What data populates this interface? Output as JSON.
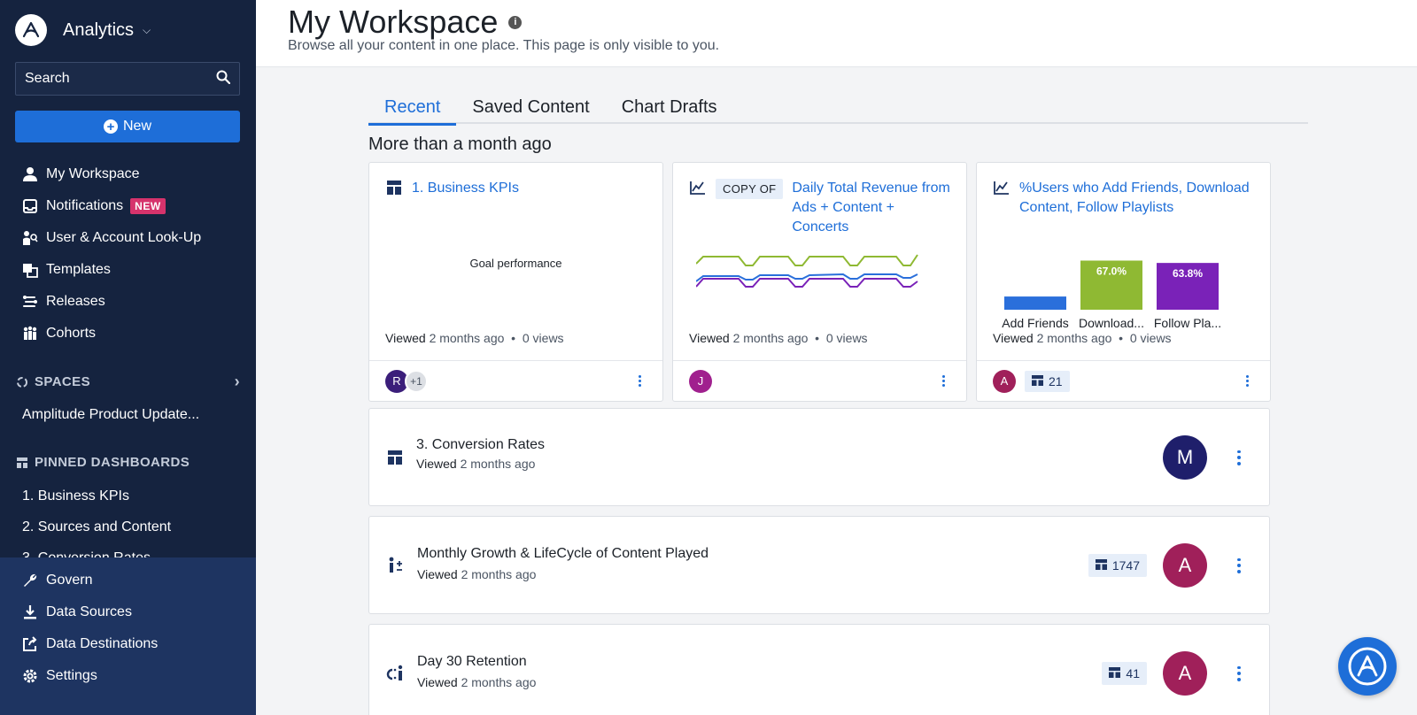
{
  "brand": {
    "name": "Analytics"
  },
  "search": {
    "label": "Search"
  },
  "new_button": {
    "label": "New"
  },
  "nav": {
    "items": [
      {
        "label": "My Workspace",
        "icon": "person-icon"
      },
      {
        "label": "Notifications",
        "icon": "inbox-icon",
        "badge": "NEW"
      },
      {
        "label": "User & Account Look-Up",
        "icon": "user-lookup-icon"
      },
      {
        "label": "Templates",
        "icon": "templates-icon"
      },
      {
        "label": "Releases",
        "icon": "releases-icon"
      },
      {
        "label": "Cohorts",
        "icon": "cohorts-icon"
      }
    ]
  },
  "spaces": {
    "title": "SPACES",
    "items": [
      "Amplitude Product Update..."
    ]
  },
  "pinned": {
    "title": "PINNED DASHBOARDS",
    "items": [
      "1. Business KPIs",
      "2. Sources and Content",
      "3. Conversion Rates"
    ]
  },
  "bottom_nav": {
    "items": [
      {
        "label": "Govern",
        "icon": "wrench-icon"
      },
      {
        "label": "Data Sources",
        "icon": "download-icon"
      },
      {
        "label": "Data Destinations",
        "icon": "share-icon"
      },
      {
        "label": "Settings",
        "icon": "gear-icon"
      }
    ]
  },
  "header": {
    "title": "My Workspace",
    "subtitle": "Browse all your content in one place. This page is only visible to you."
  },
  "tabs": [
    "Recent",
    "Saved Content",
    "Chart Drafts"
  ],
  "group_title": "More than a month ago",
  "cards": [
    {
      "title": "1. Business KPIs",
      "preview_text": "Goal performance",
      "viewed_label": "Viewed",
      "viewed_time": "2 months ago",
      "views": "0 views",
      "avatar": "R",
      "avatar_color": "#3b1e7a",
      "extra": "+1"
    },
    {
      "copy_label": "COPY OF",
      "title": "Daily Total Revenue from Ads + Content + Concerts",
      "viewed_label": "Viewed",
      "viewed_time": "2 months ago",
      "views": "0 views",
      "avatar": "J",
      "avatar_color": "#a0208e"
    },
    {
      "title": "%Users who Add Friends, Download Content, Follow Playlists",
      "viewed_label": "Viewed",
      "viewed_time": "2 months ago",
      "views": "0 views",
      "avatar": "A",
      "avatar_color": "#a0205a",
      "count": "21"
    }
  ],
  "chart_data": {
    "type": "bar",
    "categories": [
      "Add Friends",
      "Download...",
      "Follow Pla..."
    ],
    "values": [
      18,
      67.0,
      63.8
    ],
    "data_labels": [
      "",
      "67.0%",
      "63.8%"
    ],
    "colors": [
      "#2a6fdb",
      "#8fb933",
      "#7a22b8"
    ]
  },
  "rows": [
    {
      "title": "3. Conversion Rates",
      "viewed_label": "Viewed",
      "viewed_time": "2 months ago",
      "avatar": "M",
      "avatar_color": "#1f1f6b",
      "icon": "dashboard-icon"
    },
    {
      "title": "Monthly Growth & LifeCycle of Content Played",
      "viewed_label": "Viewed",
      "viewed_time": "2 months ago",
      "avatar": "A",
      "avatar_color": "#a0205a",
      "count": "1747",
      "icon": "lifecycle-icon"
    },
    {
      "title": "Day 30 Retention",
      "viewed_label": "Viewed",
      "viewed_time": "2 months ago",
      "avatar": "A",
      "avatar_color": "#a0205a",
      "count": "41",
      "icon": "retention-icon"
    }
  ]
}
